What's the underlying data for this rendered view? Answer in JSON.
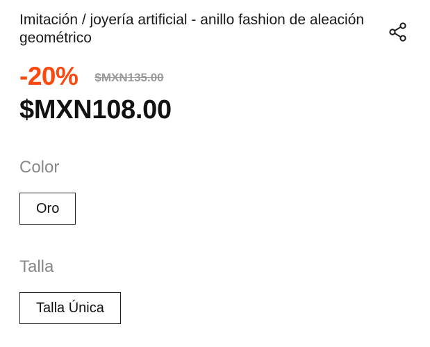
{
  "product": {
    "title": "Imitación / joyería artificial - anillo fashion de aleación geométrico",
    "discount": "-20%",
    "original_price": "$MXN135.00",
    "current_price": "$MXN108.00"
  },
  "color": {
    "label": "Color",
    "options": [
      "Oro"
    ],
    "selected": "Oro"
  },
  "size": {
    "label": "Talla",
    "options": [
      "Talla Única"
    ],
    "selected": "Talla Única"
  },
  "icons": {
    "share": "share-icon"
  },
  "colors": {
    "discount": "#fa4a10",
    "muted": "#888888",
    "text": "#111111"
  }
}
